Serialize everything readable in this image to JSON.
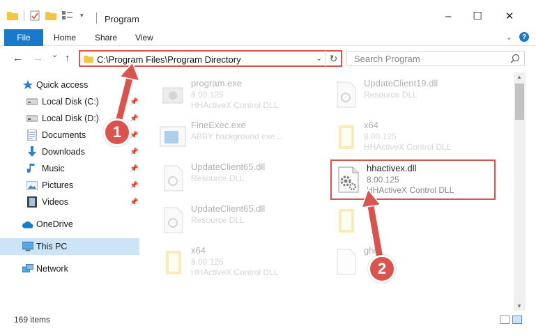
{
  "window": {
    "title": "Program",
    "minimize": "–",
    "maximize": "☐",
    "close": "✕"
  },
  "ribbon": {
    "file": "File",
    "home": "Home",
    "share": "Share",
    "view": "View"
  },
  "nav": {
    "back": "←",
    "forward": "→",
    "recent": "⌄",
    "up": "↑",
    "address_path": "C:\\Program Files\\Program Directory",
    "search_placeholder": "Search Program"
  },
  "sidebar": {
    "items": [
      {
        "label": "Quick access",
        "icon": "star-icon",
        "pinned": false
      },
      {
        "label": "Local Disk (C:)",
        "icon": "drive-icon",
        "pinned": true
      },
      {
        "label": "Local Disk (D:)",
        "icon": "drive-icon",
        "pinned": true
      },
      {
        "label": "Documents",
        "icon": "documents-icon",
        "pinned": true
      },
      {
        "label": "Downloads",
        "icon": "downloads-icon",
        "pinned": true
      },
      {
        "label": "Music",
        "icon": "music-icon",
        "pinned": true
      },
      {
        "label": "Pictures",
        "icon": "pictures-icon",
        "pinned": true
      },
      {
        "label": "Videos",
        "icon": "videos-icon",
        "pinned": true
      },
      {
        "label": "OneDrive",
        "icon": "cloud-icon",
        "pinned": false
      },
      {
        "label": "This PC",
        "icon": "pc-icon",
        "pinned": false,
        "selected": true
      },
      {
        "label": "Network",
        "icon": "network-icon",
        "pinned": false
      }
    ]
  },
  "files": [
    {
      "name": "program.exe",
      "line2": "8.00.125",
      "line3": "HHActiveX Control DLL",
      "icon": "exe-icon",
      "faded": true
    },
    {
      "name": "UpdateClient19.dll",
      "line2": "Resource DLL",
      "line3": "",
      "icon": "dll-icon",
      "faded": true
    },
    {
      "name": "FineExec.exe",
      "line2": "ABBY background exe...",
      "line3": "",
      "icon": "app-window-icon",
      "faded": true
    },
    {
      "name": "x64",
      "line2": "8.00.125",
      "line3": "HHActiveX Control DLL",
      "icon": "folder-icon",
      "faded": true
    },
    {
      "name": "UpdateClient65.dll",
      "line2": "Resource DLL",
      "line3": "",
      "icon": "dll-icon",
      "faded": true
    },
    {
      "name": "hhactivex.dll",
      "line2": "8.00.125",
      "line3": "HHActiveX Control DLL",
      "icon": "dll-gear-icon",
      "faded": false
    },
    {
      "name": "UpdateClient65.dll",
      "line2": "Resource DLL",
      "line3": "",
      "icon": "dll-icon",
      "faded": true
    },
    {
      "name": "",
      "line2": "",
      "line3": "",
      "icon": "folder-icon",
      "faded": true
    },
    {
      "name": "x64",
      "line2": "8.00.125",
      "line3": "HHActiveX Control DLL",
      "icon": "folder-icon",
      "faded": true
    },
    {
      "name": "ghijk",
      "line2": "",
      "line3": "",
      "icon": "blank-file-icon",
      "faded": true
    }
  ],
  "status": {
    "item_count": "169 items"
  },
  "annotations": {
    "step1": "1",
    "step2": "2"
  },
  "colors": {
    "accent": "#1979ca",
    "selection": "#cce4f7",
    "annotation": "#d9534f",
    "folder": "#f5c443"
  }
}
